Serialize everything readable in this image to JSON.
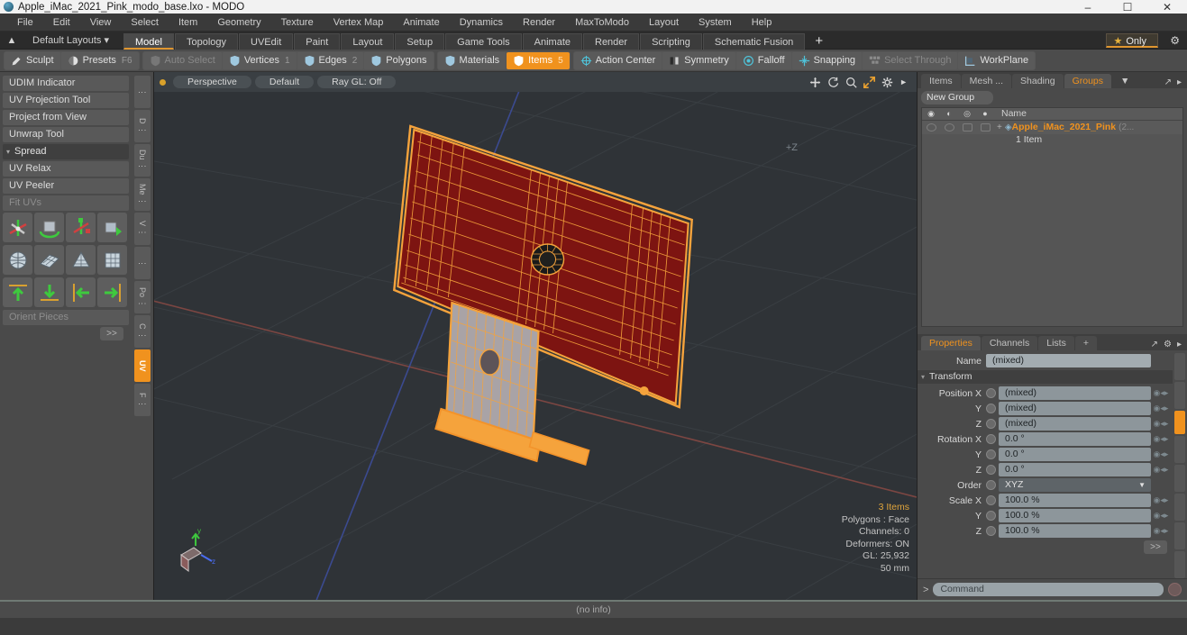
{
  "titlebar": {
    "title": "Apple_iMac_2021_Pink_modo_base.lxo - MODO",
    "minimize": "–",
    "maximize": "☐",
    "close": "✕"
  },
  "menubar": {
    "items": [
      "File",
      "Edit",
      "View",
      "Select",
      "Item",
      "Geometry",
      "Texture",
      "Vertex Map",
      "Animate",
      "Dynamics",
      "Render",
      "MaxToModo",
      "Layout",
      "System",
      "Help"
    ]
  },
  "layoutbar": {
    "default_layouts": "Default Layouts",
    "tabs": [
      "Model",
      "Topology",
      "UVEdit",
      "Paint",
      "Layout",
      "Setup",
      "Game Tools",
      "Animate",
      "Render",
      "Scripting",
      "Schematic Fusion"
    ],
    "active_tab": "Model",
    "plus": "+",
    "only_label": "Only"
  },
  "modebar": {
    "left": [
      {
        "label": "Sculpt",
        "icon": "brush-icon",
        "state": "normal"
      },
      {
        "label": "Presets",
        "icon": "sphere-icon",
        "state": "normal",
        "shortcut": "F6"
      }
    ],
    "select": [
      {
        "label": "Auto Select",
        "icon": "shield-icon",
        "state": "dim"
      },
      {
        "label": "Vertices",
        "icon": "shield-icon",
        "state": "normal",
        "num": "1"
      },
      {
        "label": "Edges",
        "icon": "shield-icon",
        "state": "normal",
        "num": "2"
      },
      {
        "label": "Polygons",
        "icon": "shield-icon",
        "state": "normal"
      }
    ],
    "items": [
      {
        "label": "Materials",
        "icon": "shield-icon",
        "state": "normal"
      },
      {
        "label": "Items",
        "icon": "shield-icon",
        "state": "selected",
        "num": "5"
      }
    ],
    "right": [
      {
        "label": "Action Center",
        "icon": "target-icon",
        "state": "normal"
      },
      {
        "label": "Symmetry",
        "icon": "mirror-icon",
        "state": "normal"
      },
      {
        "label": "Falloff",
        "icon": "circle-icon",
        "state": "normal"
      },
      {
        "label": "Snapping",
        "icon": "snap-icon",
        "state": "normal"
      },
      {
        "label": "Select Through",
        "icon": "through-icon",
        "state": "dim"
      },
      {
        "label": "WorkPlane",
        "icon": "plane-icon",
        "state": "normal"
      }
    ]
  },
  "sidebar": {
    "rows": [
      {
        "label": "UDIM Indicator",
        "type": "button"
      },
      {
        "label": "UV Projection Tool",
        "type": "button"
      },
      {
        "label": "Project from View",
        "type": "button"
      },
      {
        "label": "Unwrap Tool",
        "type": "button"
      },
      {
        "label": "Spread",
        "type": "section"
      },
      {
        "label": "UV Relax",
        "type": "button"
      },
      {
        "label": "UV Peeler",
        "type": "button"
      },
      {
        "label": "Fit UVs",
        "type": "disabled"
      }
    ],
    "icon_rows": [
      [
        "move-axis-icon",
        "rotate-cube-icon",
        "scale-axis-icon",
        "box-transform-icon"
      ],
      [
        "sphere-uv-icon",
        "plane-uv-icon",
        "cone-uv-icon",
        "cube-uv-icon"
      ],
      [
        "align-up-icon",
        "align-down-icon",
        "align-left-icon",
        "align-right-icon"
      ]
    ],
    "orient": "Orient Pieces",
    "more_button": ">>",
    "vtabs": [
      {
        "label": "⋮",
        "active": false
      },
      {
        "label": "D ⋮",
        "active": false
      },
      {
        "label": "Du ⋮",
        "active": false
      },
      {
        "label": "Me ⋮",
        "active": false
      },
      {
        "label": "V ⋮",
        "active": false
      },
      {
        "label": "⋮",
        "active": false
      },
      {
        "label": "Po ⋮",
        "active": false
      },
      {
        "label": "C ⋮",
        "active": false
      },
      {
        "label": "UV",
        "active": true
      },
      {
        "label": "F ⋮",
        "active": false
      }
    ]
  },
  "viewport": {
    "view_mode": "Perspective",
    "shading": "Default",
    "raygl": "Ray GL: Off",
    "axis_label": "+Z",
    "icons": [
      "move-icon",
      "rotate-icon",
      "zoom-icon",
      "fit-icon",
      "gear-icon",
      "chevron-right-icon"
    ],
    "stats": {
      "items": "3 Items",
      "polygons": "Polygons : Face",
      "channels": "Channels: 0",
      "deformers": "Deformers: ON",
      "gl": "GL: 25,932",
      "scale": "50 mm"
    },
    "status": "(no info)"
  },
  "rightpanel": {
    "tabs": [
      {
        "label": "Items",
        "active": false
      },
      {
        "label": "Mesh ...",
        "active": false
      },
      {
        "label": "Shading",
        "active": false
      },
      {
        "label": "Groups",
        "active": true
      }
    ],
    "dropdown_arrow": "▼",
    "expand_icon": "expand-icon",
    "chevron": "▸",
    "new_group": "New Group",
    "table": {
      "col_icons": [
        "eye-icon",
        "render-icon",
        "wire-icon",
        "lock-icon"
      ],
      "name_header": "Name",
      "row": {
        "name": "Apple_iMac_2021_Pink",
        "count": "(2...",
        "sub": "1 Item",
        "plus": "+"
      }
    },
    "properties": {
      "tabs": [
        {
          "label": "Properties",
          "active": true
        },
        {
          "label": "Channels",
          "active": false
        },
        {
          "label": "Lists",
          "active": false
        },
        {
          "label": "+",
          "active": false
        }
      ],
      "name_label": "Name",
      "name_value": "(mixed)",
      "transform_label": "Transform",
      "fields": [
        {
          "label": "Position X",
          "value": "(mixed)"
        },
        {
          "label": "Y",
          "value": "(mixed)"
        },
        {
          "label": "Z",
          "value": "(mixed)"
        },
        {
          "label": "Rotation X",
          "value": "0.0 °"
        },
        {
          "label": "Y",
          "value": "0.0 °"
        },
        {
          "label": "Z",
          "value": "0.0 °"
        },
        {
          "label": "Order",
          "value": "XYZ",
          "type": "select"
        },
        {
          "label": "Scale X",
          "value": "100.0 %"
        },
        {
          "label": "Y",
          "value": "100.0 %"
        },
        {
          "label": "Z",
          "value": "100.0 %"
        }
      ],
      "more_button": ">>"
    },
    "command": {
      "prompt": ">",
      "placeholder": "Command",
      "record": "record-icon"
    }
  },
  "colors": {
    "accent": "#f0921e",
    "wire": "#f5a33c",
    "face": "#7d1411",
    "panel": "#4a4a4a",
    "viewport_bg": "#2f3337"
  }
}
